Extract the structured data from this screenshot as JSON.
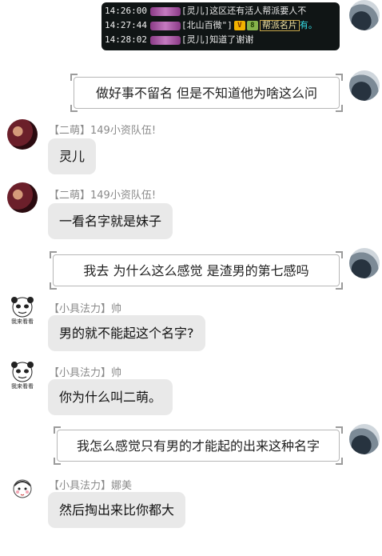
{
  "game_log": {
    "lines": [
      {
        "time": "14:26:00",
        "text": "[灵儿]这区还有活人帮派要人不"
      },
      {
        "time": "14:27:44",
        "text": "[北山百微\"]",
        "badge_v": "V",
        "badge_n": "8",
        "tag": "帮派名片",
        "suffix": "有。"
      },
      {
        "time": "14:28:02",
        "text": "[灵儿]知道了谢谢"
      }
    ]
  },
  "messages": [
    {
      "side": "out",
      "text": "做好事不留名   但是不知道他为啥这么问"
    },
    {
      "side": "in",
      "sender": "【二萌】149小资队伍!",
      "text": "灵儿"
    },
    {
      "side": "in",
      "sender": "【二萌】149小资队伍!",
      "text": "一看名字就是妹子"
    },
    {
      "side": "out",
      "text": "我去    为什么这么感觉    是渣男的第七感吗"
    },
    {
      "side": "in",
      "sender": "【小具法力】帅",
      "text": "男的就不能起这个名字?"
    },
    {
      "side": "in",
      "sender": "【小具法力】帅",
      "text": "你为什么叫二萌。"
    },
    {
      "side": "out",
      "text": "我怎么感觉只有男的才能起的出来这种名字"
    },
    {
      "side": "in",
      "sender": "【小具法力】娜美",
      "text": "然后掏出来比你都大"
    }
  ],
  "meme_avatar_caption": "我来看看"
}
